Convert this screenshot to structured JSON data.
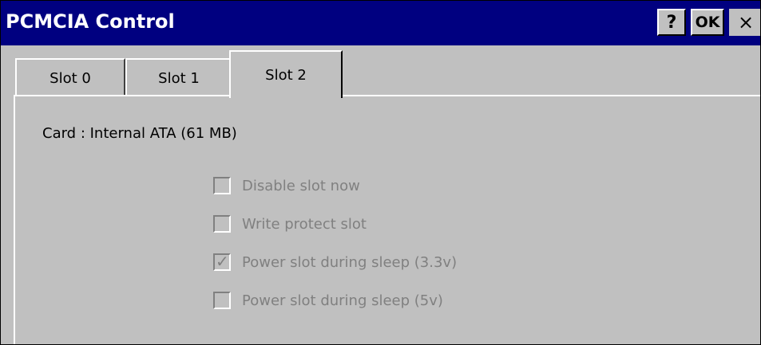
{
  "window": {
    "title": "PCMCIA Control",
    "help_label": "?",
    "ok_label": "OK",
    "close_label": "×"
  },
  "tabs": [
    {
      "label": "Slot 0"
    },
    {
      "label": "Slot 1"
    },
    {
      "label": "Slot 2",
      "active": true
    }
  ],
  "panel": {
    "card_text": "Card : Internal ATA (61 MB)",
    "options": [
      {
        "label": "Disable slot now",
        "checked": false,
        "enabled": false
      },
      {
        "label": "Write protect slot",
        "checked": false,
        "enabled": false
      },
      {
        "label": "Power slot during sleep (3.3v)",
        "checked": true,
        "enabled": false
      },
      {
        "label": "Power slot during sleep (5v)",
        "checked": false,
        "enabled": false
      }
    ]
  },
  "colors": {
    "titlebar": "#000080",
    "face": "#c0c0c0",
    "disabled_text": "#808080"
  }
}
